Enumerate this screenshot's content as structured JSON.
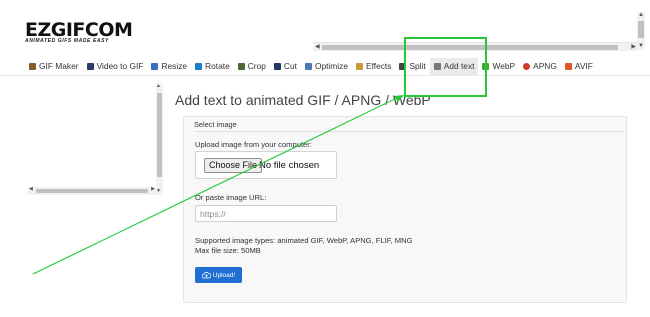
{
  "logo": {
    "title": "EZGIFCOM",
    "tagline": "ANIMATED GIFS MADE EASY"
  },
  "nav": {
    "items": [
      {
        "label": "GIF Maker",
        "icon": "gif-maker-icon",
        "color": "#8a5a2a"
      },
      {
        "label": "Video to GIF",
        "icon": "video-icon",
        "color": "#2a3a6a"
      },
      {
        "label": "Resize",
        "icon": "resize-icon",
        "color": "#3a6ec0"
      },
      {
        "label": "Rotate",
        "icon": "rotate-icon",
        "color": "#1a80c8"
      },
      {
        "label": "Crop",
        "icon": "crop-icon",
        "color": "#4a6a3a"
      },
      {
        "label": "Cut",
        "icon": "cut-icon",
        "color": "#223366"
      },
      {
        "label": "Optimize",
        "icon": "optimize-icon",
        "color": "#4a78b0"
      },
      {
        "label": "Effects",
        "icon": "effects-icon",
        "color": "#c89a3a"
      },
      {
        "label": "Split",
        "icon": "split-icon",
        "color": "#444444"
      },
      {
        "label": "Add text",
        "icon": "text-icon",
        "color": "#777777",
        "active": true
      },
      {
        "label": "WebP",
        "icon": "webp-icon",
        "color": "#46a832"
      },
      {
        "label": "APNG",
        "icon": "apng-icon",
        "color": "#d23a2a"
      },
      {
        "label": "AVIF",
        "icon": "avif-icon",
        "color": "#e0582a"
      }
    ]
  },
  "main": {
    "title": "Add text to animated GIF / APNG / WebP",
    "legend": "Select image",
    "upload_label": "Upload image from your computer:",
    "file_button": "Choose File",
    "file_status": "No file chosen",
    "url_label": "Or paste image URL:",
    "url_placeholder": "https://",
    "supported": "Supported image types: animated GIF, WebP, APNG, FLIF, MNG",
    "max_size": "Max file size: 50MB",
    "upload_button": "Upload!"
  },
  "colors": {
    "accent": "#1e6fd1",
    "annotation": "#22c934"
  }
}
